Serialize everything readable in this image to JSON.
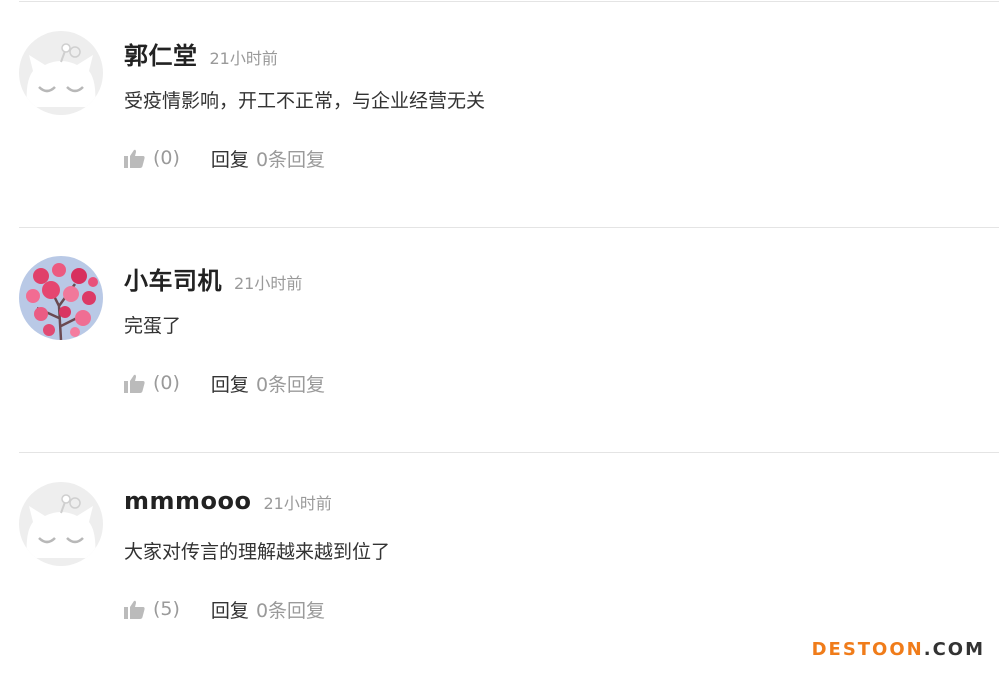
{
  "comments": [
    {
      "username": "郭仁堂",
      "time": "21小时前",
      "content": "受疫情影响，开工不正常，与企业经营无关",
      "likes": "(0)",
      "reply_label": "回复",
      "reply_count": "0条回复",
      "avatar": "default-cat-avatar-icon"
    },
    {
      "username": "小车司机",
      "time": "21小时前",
      "content": "完蛋了",
      "likes": "(0)",
      "reply_label": "回复",
      "reply_count": "0条回复",
      "avatar": "plum-blossom-photo-avatar"
    },
    {
      "username": "mmmooo",
      "time": "21小时前",
      "content": "大家对传言的理解越来越到位了",
      "likes": "(5)",
      "reply_label": "回复",
      "reply_count": "0条回复",
      "avatar": "default-cat-avatar-icon"
    }
  ],
  "watermark": {
    "part1": "DESTOON",
    "part2": ".COM"
  },
  "colors": {
    "username": "#222222",
    "meta": "#9a9a9a",
    "content": "#333333",
    "divider": "#e4e4e4",
    "watermark_accent": "#f07c1a"
  }
}
